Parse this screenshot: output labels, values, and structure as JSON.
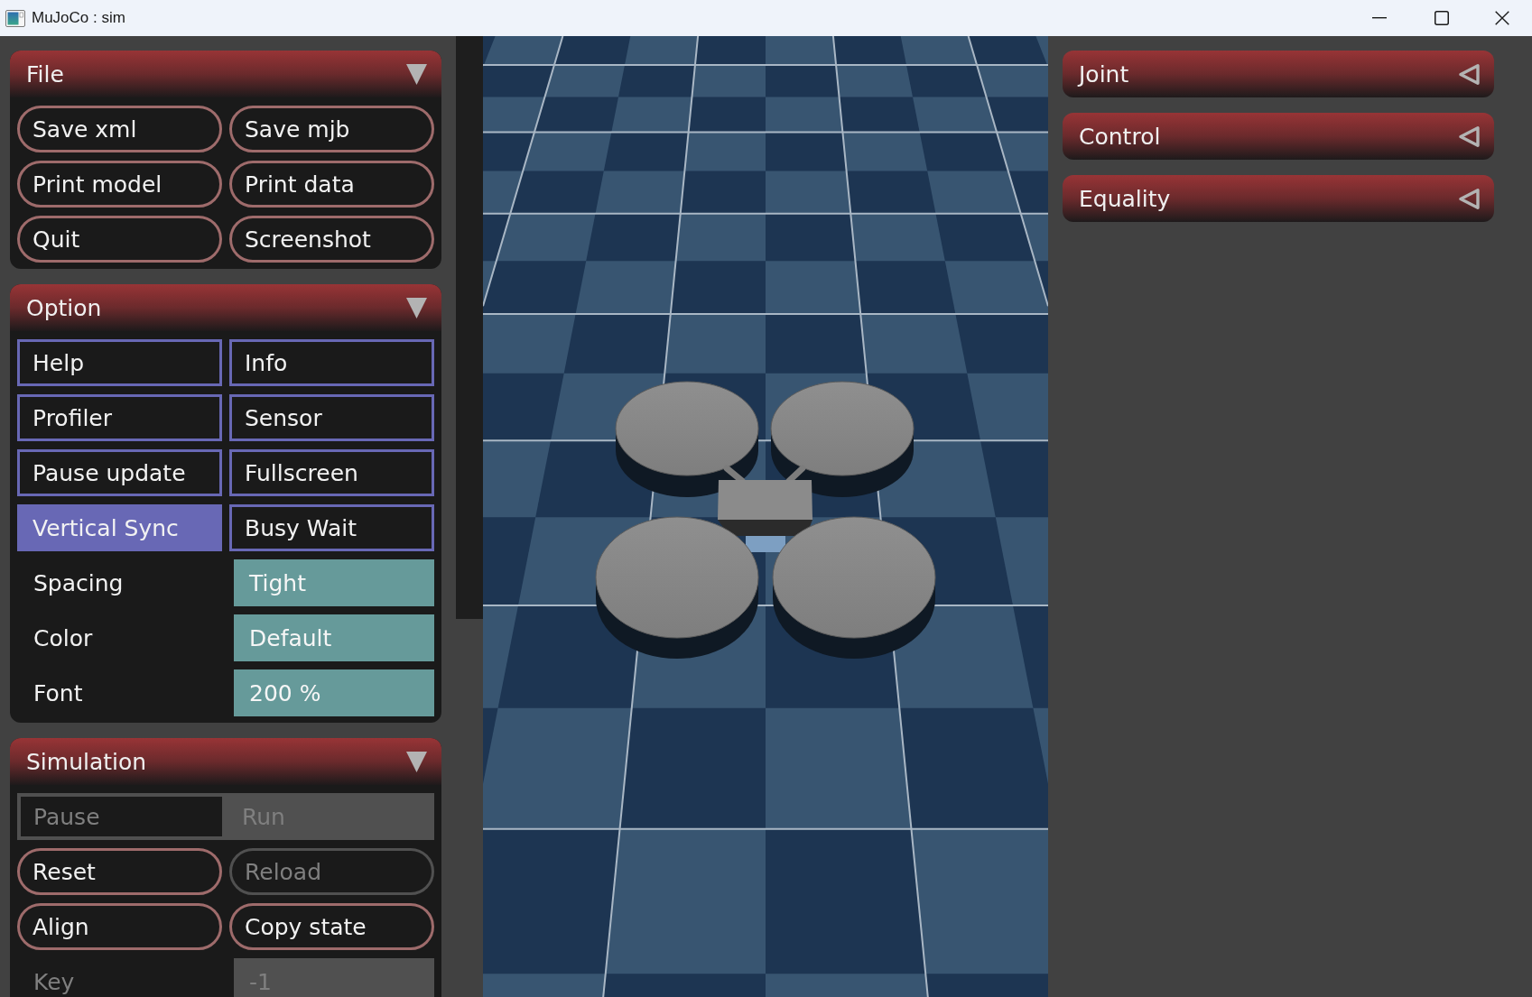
{
  "window": {
    "title": "MuJoCo : sim"
  },
  "left_panel": {
    "sections": [
      {
        "title": "File",
        "expanded": true,
        "items": [
          {
            "kind": "button",
            "label": "Save xml",
            "disabled": false
          },
          {
            "kind": "button",
            "label": "Save mjb",
            "disabled": false
          },
          {
            "kind": "button",
            "label": "Print model",
            "disabled": false
          },
          {
            "kind": "button",
            "label": "Print data",
            "disabled": false
          },
          {
            "kind": "button",
            "label": "Quit",
            "disabled": false
          },
          {
            "kind": "button",
            "label": "Screenshot",
            "disabled": false
          }
        ]
      },
      {
        "title": "Option",
        "expanded": true,
        "items": [
          {
            "kind": "checkbox",
            "label": "Help",
            "checked": false,
            "disabled": false
          },
          {
            "kind": "checkbox",
            "label": "Info",
            "checked": false,
            "disabled": false
          },
          {
            "kind": "checkbox",
            "label": "Profiler",
            "checked": false,
            "disabled": false
          },
          {
            "kind": "checkbox",
            "label": "Sensor",
            "checked": false,
            "disabled": false
          },
          {
            "kind": "checkbox",
            "label": "Pause update",
            "checked": false,
            "disabled": false
          },
          {
            "kind": "checkbox",
            "label": "Fullscreen",
            "checked": false,
            "disabled": false
          },
          {
            "kind": "checkbox",
            "label": "Vertical Sync",
            "checked": true,
            "disabled": false
          },
          {
            "kind": "checkbox",
            "label": "Busy Wait",
            "checked": false,
            "disabled": false
          },
          {
            "kind": "select",
            "label": "Spacing",
            "value": "Tight",
            "disabled": false
          },
          {
            "kind": "select",
            "label": "Color",
            "value": "Default",
            "disabled": false
          },
          {
            "kind": "select",
            "label": "Font",
            "value": "200 %",
            "disabled": false
          }
        ]
      },
      {
        "title": "Simulation",
        "expanded": true,
        "items": [
          {
            "kind": "radio",
            "disabled": true,
            "options": [
              {
                "label": "Pause",
                "selected": false
              },
              {
                "label": "Run",
                "selected": true
              }
            ]
          },
          {
            "kind": "button",
            "label": "Reset",
            "disabled": false
          },
          {
            "kind": "button",
            "label": "Reload",
            "disabled": true
          },
          {
            "kind": "button",
            "label": "Align",
            "disabled": false
          },
          {
            "kind": "button",
            "label": "Copy state",
            "disabled": false
          },
          {
            "kind": "edit",
            "label": "Key",
            "value": "-1",
            "disabled": true
          }
        ]
      }
    ]
  },
  "right_panel": {
    "sections": [
      {
        "title": "Joint",
        "expanded": false
      },
      {
        "title": "Control",
        "expanded": false
      },
      {
        "title": "Equality",
        "expanded": false
      }
    ]
  }
}
